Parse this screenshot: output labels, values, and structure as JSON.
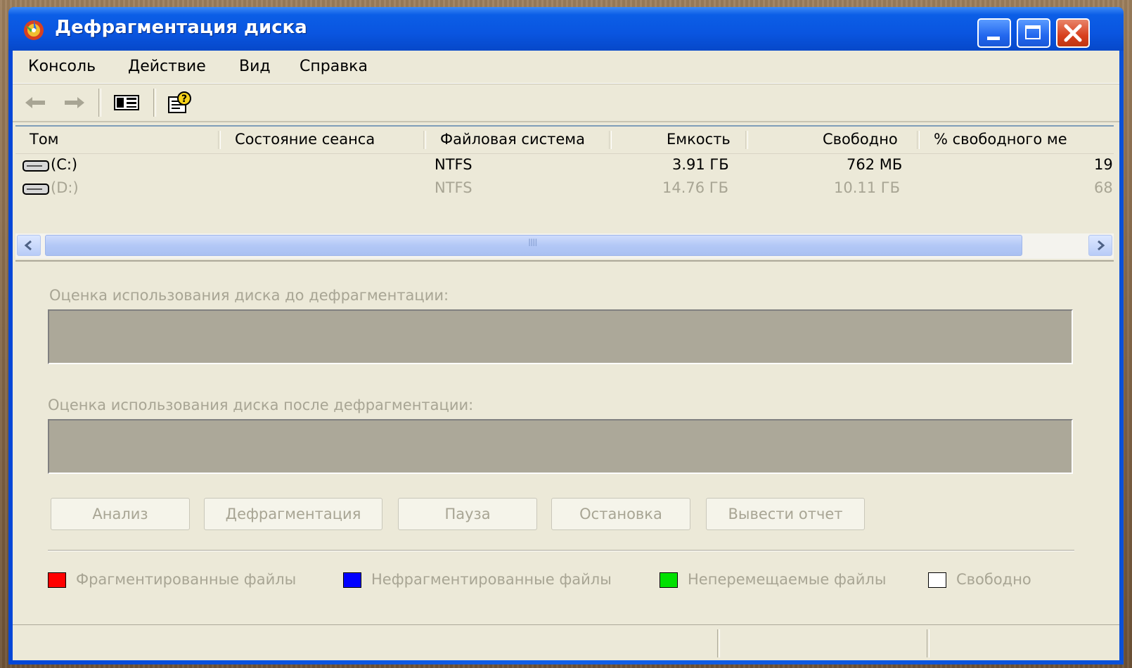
{
  "window": {
    "title": "Дефрагментация диска",
    "accent": "#0a55e0"
  },
  "menu": [
    "Консоль",
    "Действие",
    "Вид",
    "Справка"
  ],
  "toolbar": {
    "icons": [
      "back-arrow-icon",
      "forward-arrow-icon",
      "show-hide-tree-icon",
      "help-icon"
    ]
  },
  "volumes": {
    "headers": [
      "Том",
      "Состояние сеанса",
      "Файловая система",
      "Емкость",
      "Свободно",
      "% свободного ме"
    ],
    "rows": [
      {
        "name": "(C:)",
        "status": "",
        "fs": "NTFS",
        "capacity": "3.91 ГБ",
        "free": "762 МБ",
        "pct": "19"
      },
      {
        "name": "(D:)",
        "status": "",
        "fs": "NTFS",
        "capacity": "14.76 ГБ",
        "free": "10.11 ГБ",
        "pct": "68"
      }
    ],
    "scroll_grip": "IIII"
  },
  "analysis": {
    "before_label": "Оценка использования диска до дефрагментации:",
    "after_label": "Оценка использования диска после дефрагментации:"
  },
  "buttons": {
    "analyze": "Анализ",
    "defrag": "Дефрагментация",
    "pause": "Пауза",
    "stop": "Остановка",
    "report": "Вывести отчет"
  },
  "legend": [
    {
      "label": "Фрагментированные файлы",
      "color": "#ff0000"
    },
    {
      "label": "Нефрагментированные файлы",
      "color": "#0000ff"
    },
    {
      "label": "Неперемещаемые файлы",
      "color": "#00e000"
    },
    {
      "label": "Свободно",
      "color": "#ffffff"
    }
  ]
}
